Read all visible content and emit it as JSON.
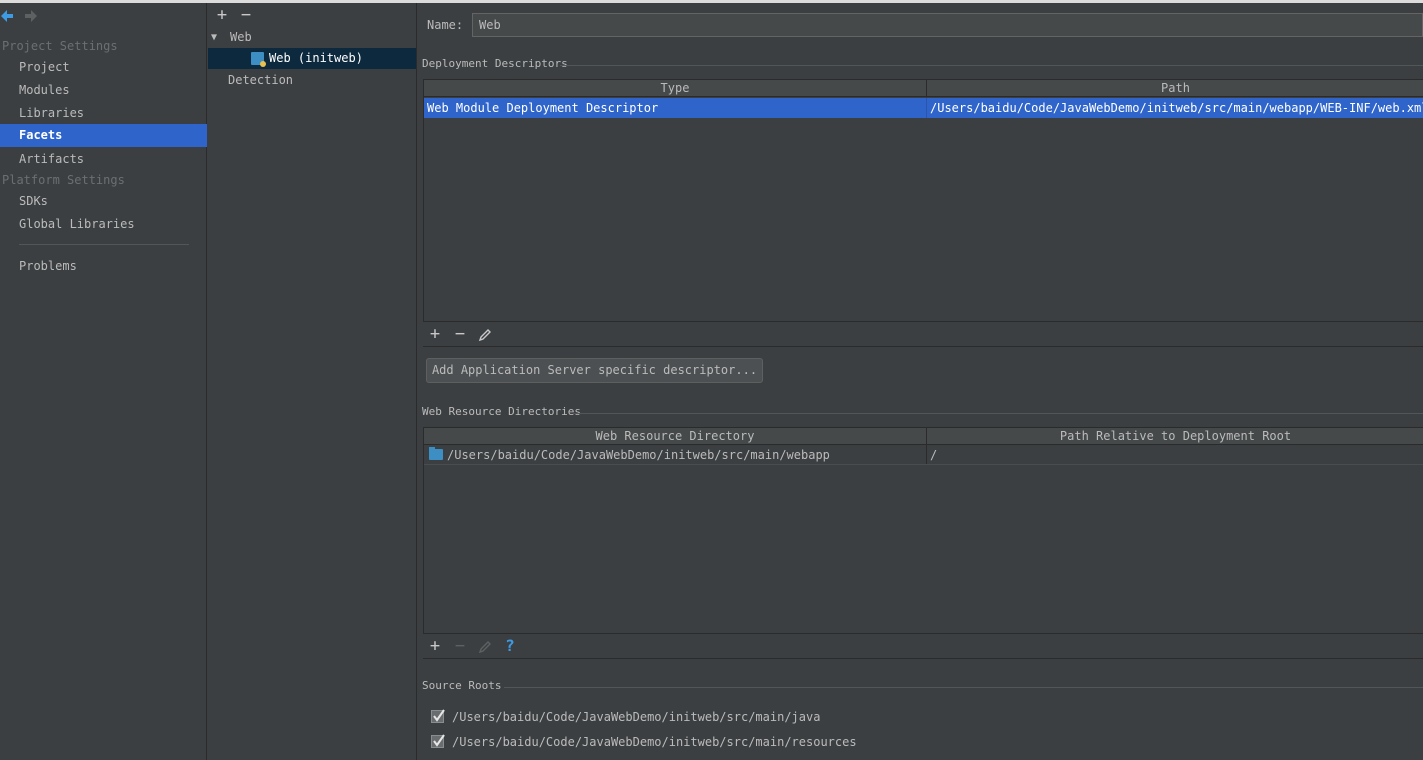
{
  "sidebar": {
    "project_settings_header": "Project Settings",
    "platform_settings_header": "Platform Settings",
    "items": {
      "project": "Project",
      "modules": "Modules",
      "libraries": "Libraries",
      "facets": "Facets",
      "artifacts": "Artifacts",
      "sdks": "SDKs",
      "global_libraries": "Global Libraries",
      "problems": "Problems"
    },
    "selected": "Facets"
  },
  "tree": {
    "toolbar": {
      "add": "+",
      "remove": "−"
    },
    "group": "Web",
    "child": "Web (initweb)",
    "detection": "Detection"
  },
  "detail": {
    "name_label": "Name:",
    "name_value": "Web",
    "deployment": {
      "title": "Deployment Descriptors",
      "columns": [
        "Type",
        "Path"
      ],
      "rows": [
        {
          "type": "Web Module Deployment Descriptor",
          "path": "/Users/baidu/Code/JavaWebDemo/initweb/src/main/webapp/WEB-INF/web.xml"
        }
      ],
      "toolbar": {
        "add": "+",
        "remove": "−"
      },
      "add_server_button": "Add Application Server specific descriptor..."
    },
    "resources": {
      "title": "Web Resource Directories",
      "columns": [
        "Web Resource Directory",
        "Path Relative to Deployment Root"
      ],
      "rows": [
        {
          "directory": "/Users/baidu/Code/JavaWebDemo/initweb/src/main/webapp",
          "relative": "/"
        }
      ],
      "toolbar": {
        "add": "+",
        "remove": "−",
        "help": "?"
      }
    },
    "source_roots": {
      "title": "Source Roots",
      "items": [
        {
          "path": "/Users/baidu/Code/JavaWebDemo/initweb/src/main/java",
          "checked": true
        },
        {
          "path": "/Users/baidu/Code/JavaWebDemo/initweb/src/main/resources",
          "checked": true
        }
      ]
    }
  },
  "colors": {
    "background": "#3c3f41",
    "selection": "#2f65ca",
    "tree_selection": "#0d293e",
    "text": "#bbbbbb",
    "accent_icon": "#3d8fc3"
  }
}
